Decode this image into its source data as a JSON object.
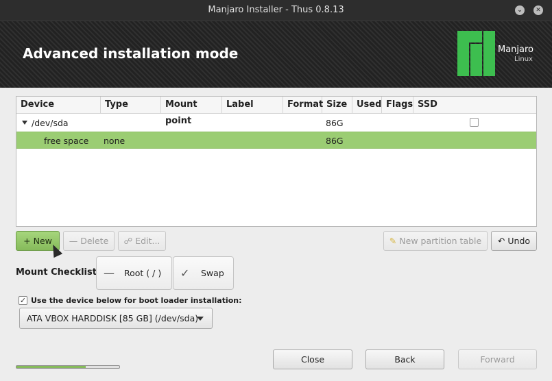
{
  "window": {
    "title": "Manjaro Installer - Thus 0.8.13"
  },
  "header": {
    "heading": "Advanced installation mode",
    "logo_name": "Manjaro",
    "logo_sub": "Linux"
  },
  "table": {
    "columns": [
      "Device",
      "Type",
      "Mount point",
      "Label",
      "Format",
      "Size",
      "Used",
      "Flags",
      "SSD"
    ],
    "rows": [
      {
        "device": "/dev/sda",
        "size": "86G",
        "ssd_checked": false
      },
      {
        "device": "free space",
        "type": "none",
        "size": "86G"
      }
    ]
  },
  "partition_buttons": {
    "new": "New",
    "delete": "Delete",
    "edit": "Edit...",
    "new_table": "New partition table",
    "undo": "Undo"
  },
  "mount_checklist": {
    "label": "Mount Checklist:",
    "root": "Root ( / )",
    "swap": "Swap"
  },
  "bootloader": {
    "label": "Use the device below for boot loader installation:",
    "checked": true,
    "device": "ATA VBOX HARDDISK [85 GB] (/dev/sda)"
  },
  "nav": {
    "close": "Close",
    "back": "Back",
    "forward": "Forward"
  },
  "progress": {
    "value": 0.67
  },
  "colors": {
    "accent": "#86bb5b",
    "selection": "#9bcd73",
    "logo": "#3dbe4f"
  }
}
